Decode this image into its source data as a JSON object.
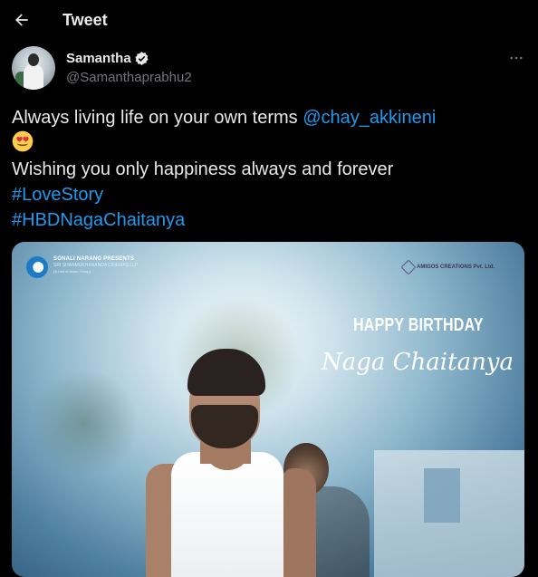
{
  "header": {
    "title": "Tweet"
  },
  "author": {
    "name": "Samantha",
    "handle": "@Samanthaprabhu2",
    "verified": true
  },
  "tweet": {
    "line1_text": "Always living life on your own terms ",
    "line1_mention": "@chay_akkineni",
    "emoji": "smiling-face-with-heart-eyes",
    "line2_text": "Wishing you only happiness always and forever",
    "hashtag1": "#LoveStory",
    "hashtag2": "#HBDNagaChaitanya"
  },
  "media": {
    "presenter_line": "SONALI NARANG PRESENTS",
    "presenter_sub": "SRI SHANMUKHANANDA CINEMAS LLP",
    "presenter_note": "(A Unit of Asian Group)",
    "production": "AMIGOS CREATIONS Pvt. Ltd.",
    "headline": "HAPPY BIRTHDAY",
    "name_script": "Naga Chaitanya"
  },
  "colors": {
    "background": "#000000",
    "text": "#e7e9ea",
    "secondary": "#71767b",
    "link": "#1d9bf0"
  }
}
